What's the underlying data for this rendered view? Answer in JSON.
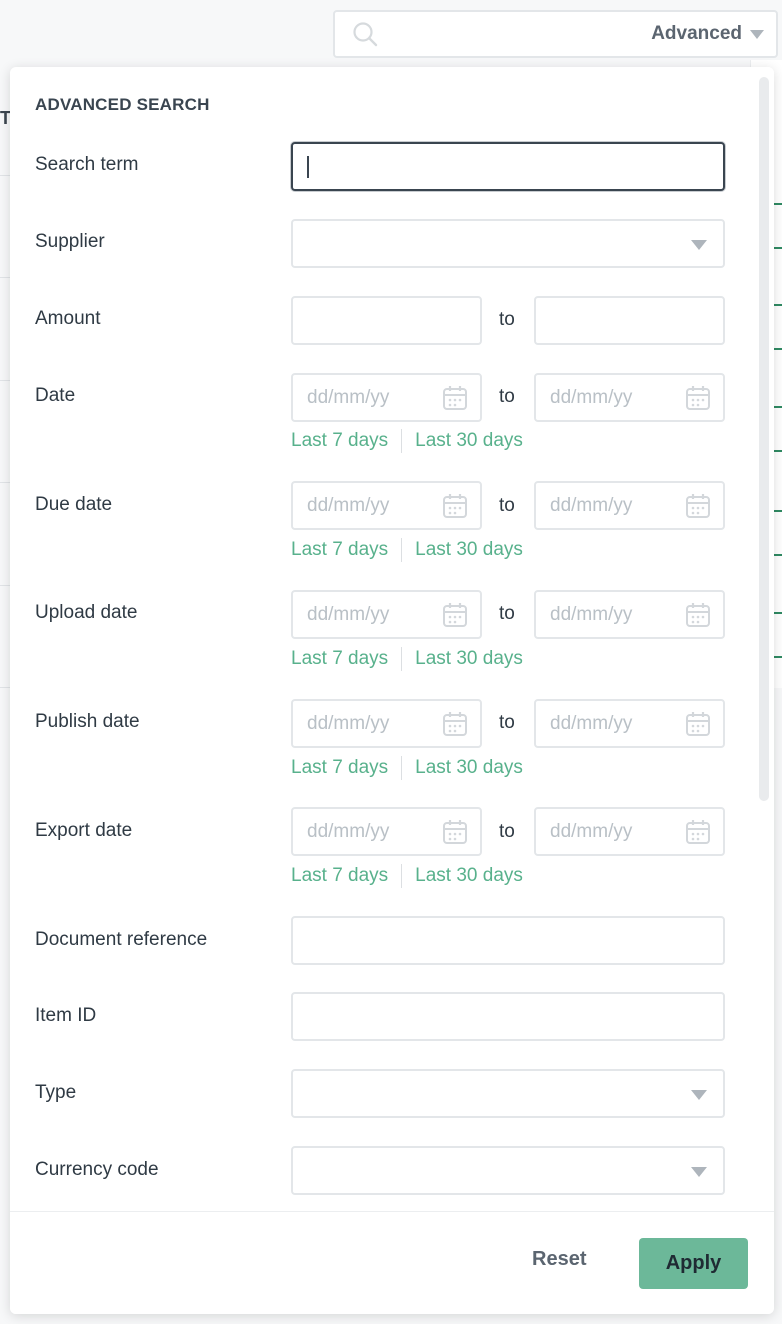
{
  "search": {
    "advanced_label": "Advanced"
  },
  "panel": {
    "title": "ADVANCED SEARCH",
    "to_label": "to",
    "date_placeholder": "dd/mm/yy",
    "quick_range": {
      "last7": "Last 7 days",
      "last30": "Last 30 days"
    },
    "fields": {
      "search_term": {
        "label": "Search term",
        "value": ""
      },
      "supplier": {
        "label": "Supplier",
        "value": ""
      },
      "amount": {
        "label": "Amount",
        "from": "",
        "to": ""
      },
      "date": {
        "label": "Date"
      },
      "due_date": {
        "label": "Due date"
      },
      "upload_date": {
        "label": "Upload date"
      },
      "publish_date": {
        "label": "Publish date"
      },
      "export_date": {
        "label": "Export date"
      },
      "document_reference": {
        "label": "Document reference",
        "value": ""
      },
      "item_id": {
        "label": "Item ID",
        "value": ""
      },
      "type": {
        "label": "Type",
        "value": ""
      },
      "currency_code": {
        "label": "Currency code",
        "value": ""
      }
    },
    "footer": {
      "reset_label": "Reset",
      "apply_label": "Apply"
    }
  },
  "colors": {
    "accent": "#58b18c",
    "apply_bg": "#6cb899",
    "text": "#2f3a44"
  }
}
